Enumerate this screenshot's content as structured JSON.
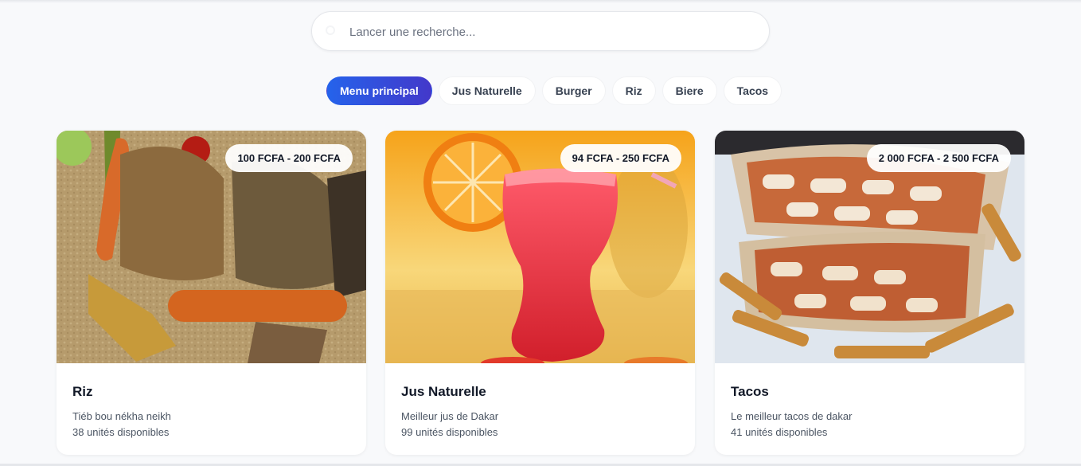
{
  "search": {
    "placeholder": "Lancer une recherche..."
  },
  "tabs": [
    {
      "label": "Menu principal",
      "active": true
    },
    {
      "label": "Jus Naturelle",
      "active": false
    },
    {
      "label": "Burger",
      "active": false
    },
    {
      "label": "Riz",
      "active": false
    },
    {
      "label": "Biere",
      "active": false
    },
    {
      "label": "Tacos",
      "active": false
    }
  ],
  "cards": [
    {
      "title": "Riz",
      "price": "100 FCFA - 200 FCFA",
      "description": "Tiéb bou nékha neikh",
      "stock": "38 unités disponibles",
      "image": "rice-fish-dish-photo"
    },
    {
      "title": "Jus Naturelle",
      "price": "94 FCFA - 250 FCFA",
      "description": "Meilleur jus de Dakar",
      "stock": "99 unités disponibles",
      "image": "orange-red-juice-photo"
    },
    {
      "title": "Tacos",
      "price": "2 000 FCFA - 2 500 FCFA",
      "description": "Le meilleur tacos de dakar",
      "stock": "41 unités disponibles",
      "image": "tacos-wrap-fries-photo"
    }
  ],
  "colors": {
    "accent_start": "#2563eb",
    "accent_end": "#4338ca",
    "background": "#f8f9fb"
  }
}
